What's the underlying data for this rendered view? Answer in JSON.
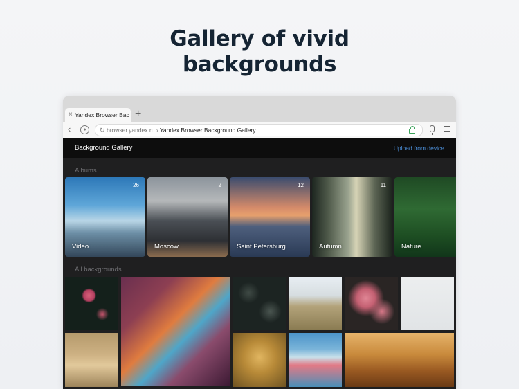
{
  "headline": {
    "line1": "Gallery of vivid",
    "line2": "backgrounds"
  },
  "browser": {
    "tab_title": "Yandex Browser Background Gallery",
    "tab_close": "×",
    "new_tab": "+",
    "address": {
      "domain": "browser.yandex.ru",
      "separator": " › ",
      "title": "Yandex Browser Background Gallery"
    }
  },
  "app": {
    "title": "Background Gallery",
    "upload_label": "Upload from device"
  },
  "albums_section": "Albums",
  "albums": [
    {
      "label": "Video",
      "count": "26"
    },
    {
      "label": "Moscow",
      "count": "2"
    },
    {
      "label": "Saint Petersburg",
      "count": "12"
    },
    {
      "label": "Autumn",
      "count": "11"
    },
    {
      "label": "Nature",
      "count": ""
    }
  ],
  "all_section": "All backgrounds",
  "icons": [
    "back-icon",
    "protect-icon",
    "reload-icon",
    "lock-icon",
    "microphone-icon",
    "menu-icon"
  ]
}
